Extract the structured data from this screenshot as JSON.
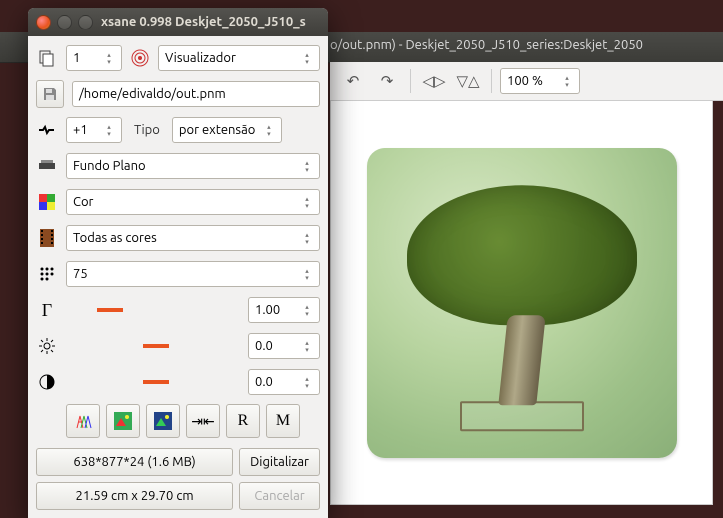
{
  "bg_window": {
    "title": "o/out.pnm) - Deskjet_2050_J510_series:Deskjet_2050",
    "zoom": "100 %"
  },
  "window": {
    "title": "xsane 0.998 Deskjet_2050_J510_s"
  },
  "row1": {
    "copies": "1",
    "mode_label": "Visualizador"
  },
  "filepath": "/home/edivaldo/out.pnm",
  "row3": {
    "step": "+1",
    "tipo_label": "Tipo",
    "tipo_value": "por extensão"
  },
  "source": "Fundo Plano",
  "colormode": "Cor",
  "colors": "Todas as cores",
  "resolution": "75",
  "gamma": "1.00",
  "brightness": "0.0",
  "contrast": "0.0",
  "info": "638*877*24 (1.6 MB)",
  "scan_btn": "Digitalizar",
  "dims": "21.59 cm x 29.70 cm",
  "cancel_btn": "Cancelar"
}
